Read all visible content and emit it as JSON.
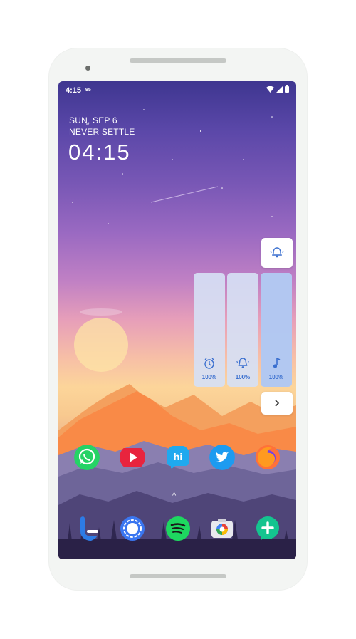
{
  "status_bar": {
    "time": "4:15",
    "extra": "95"
  },
  "lock": {
    "date": "SUN, SEP 6",
    "motto": "NEVER SETTLE",
    "clock": "04:15"
  },
  "volume_panel": {
    "ringer_mode_icon": "bell-vibrate-icon",
    "sliders": [
      {
        "icon": "alarm-icon",
        "percent": "100%",
        "level": 1.0
      },
      {
        "icon": "bell-icon",
        "percent": "100%",
        "level": 1.0
      },
      {
        "icon": "music-note-icon",
        "percent": "100%",
        "level": 1.0
      }
    ],
    "expand_icon": "chevron-right-icon"
  },
  "apps_row1": [
    "whatsapp-icon",
    "youtube-icon",
    "hike-icon",
    "twitter-icon",
    "firefox-icon"
  ],
  "apps_row2": [
    "phone-icon",
    "signal-icon",
    "spotify-icon",
    "camera-icon",
    "add-app-icon"
  ],
  "app_drawer_hint": "^",
  "colors": {
    "accent": "#3a6fcf",
    "slider_bg": "#d6e0f4",
    "slider_fill": "#b0c6f0"
  }
}
